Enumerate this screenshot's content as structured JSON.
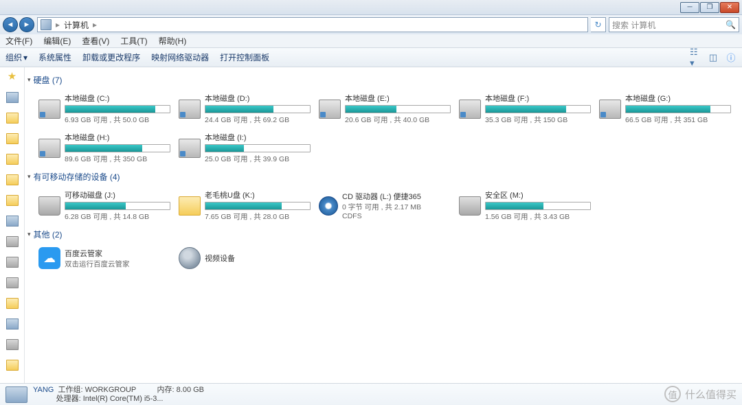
{
  "title": "计算机",
  "search_placeholder": "搜索 计算机",
  "menu": [
    "文件(F)",
    "编辑(E)",
    "查看(V)",
    "工具(T)",
    "帮助(H)"
  ],
  "toolbar": [
    "组织",
    "系统属性",
    "卸载或更改程序",
    "映射网络驱动器",
    "打开控制面板"
  ],
  "sections": {
    "hdd": {
      "label": "硬盘 (7)"
    },
    "removable": {
      "label": "有可移动存储的设备 (4)"
    },
    "other": {
      "label": "其他 (2)"
    }
  },
  "drives_hdd": [
    {
      "name": "本地磁盘 (C:)",
      "stat": "6.93 GB 可用 , 共 50.0 GB",
      "fill": 86
    },
    {
      "name": "本地磁盘 (D:)",
      "stat": "24.4 GB 可用 , 共 69.2 GB",
      "fill": 65
    },
    {
      "name": "本地磁盘 (E:)",
      "stat": "20.6 GB 可用 , 共 40.0 GB",
      "fill": 49
    },
    {
      "name": "本地磁盘 (F:)",
      "stat": "35.3 GB 可用 , 共 150 GB",
      "fill": 77
    },
    {
      "name": "本地磁盘 (G:)",
      "stat": "66.5 GB 可用 , 共 351 GB",
      "fill": 81
    },
    {
      "name": "本地磁盘 (H:)",
      "stat": "89.6 GB 可用 , 共 350 GB",
      "fill": 74
    },
    {
      "name": "本地磁盘 (I:)",
      "stat": "25.0 GB 可用 , 共 39.9 GB",
      "fill": 37
    }
  ],
  "drives_removable": [
    {
      "name": "可移动磁盘 (J:)",
      "stat": "6.28 GB 可用 , 共 14.8 GB",
      "fill": 58,
      "icon": "usb",
      "bar": true
    },
    {
      "name": "老毛桃U盘 (K:)",
      "stat": "7.65 GB 可用 , 共 28.0 GB",
      "fill": 73,
      "icon": "folder",
      "bar": true
    },
    {
      "name": "CD 驱动器 (L:) 便捷365",
      "stat": "0 字节 可用 , 共 2.17 MB",
      "sub": "CDFS",
      "icon": "cd",
      "bar": false
    },
    {
      "name": "安全区 (M:)",
      "stat": "1.56 GB 可用 , 共 3.43 GB",
      "fill": 55,
      "icon": "usb",
      "bar": true
    }
  ],
  "other_items": [
    {
      "name": "百度云管家",
      "sub": "双击运行百度云管家",
      "icon": "baidu"
    },
    {
      "name": "视频设备",
      "icon": "cam"
    }
  ],
  "details": {
    "computer": "YANG",
    "workgroup_label": "工作组:",
    "workgroup": "WORKGROUP",
    "memory_label": "内存:",
    "memory": "8.00 GB",
    "cpu_label": "处理器:",
    "cpu": "Intel(R) Core(TM) i5-3..."
  },
  "watermark": "什么值得买"
}
